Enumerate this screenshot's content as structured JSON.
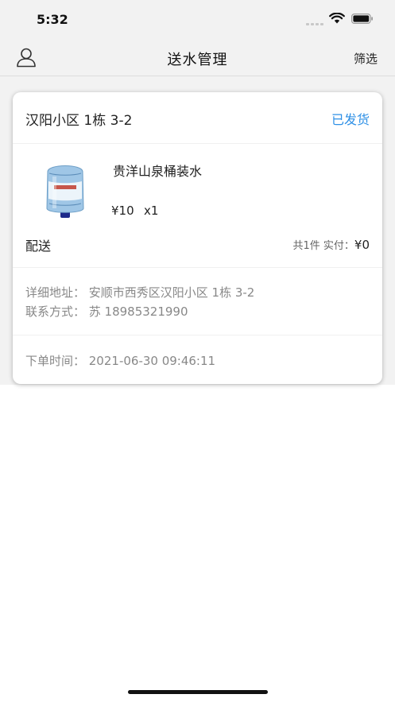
{
  "status_bar": {
    "time": "5:32"
  },
  "nav": {
    "title": "送水管理",
    "filter_label": "筛选"
  },
  "order": {
    "title": "汉阳小区 1栋 3-2",
    "status": "已发货",
    "status_color": "#2e90e6",
    "product": {
      "name": "贵洋山泉桶装水",
      "price": "¥10",
      "quantity": "x1",
      "image_icon": "water-bucket-image"
    },
    "delivery_label": "配送",
    "summary_prefix": "共1件 实付：",
    "summary_amount": "¥0",
    "address_line": "详细地址：  安顺市西秀区汉阳小区 1栋 3-2",
    "contact_line": "联系方式：  苏  18985321990",
    "order_time_line": "下单时间：  2021-06-30 09:46:11"
  }
}
